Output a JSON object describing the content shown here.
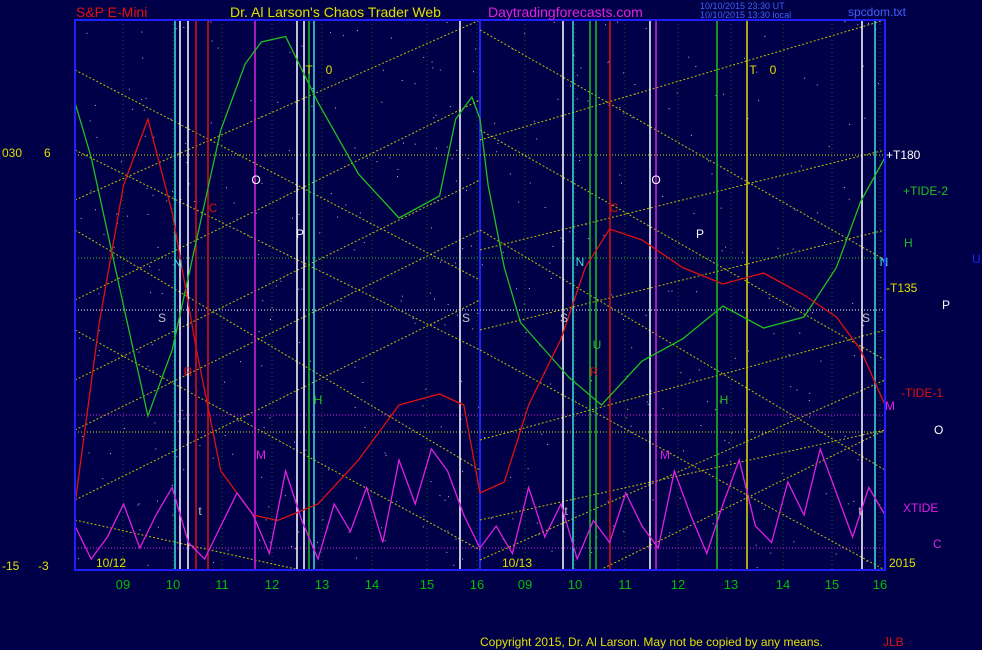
{
  "header": {
    "instrument": "S&P E-Mini",
    "title": "Dr. Al Larson's Chaos Trader Web",
    "site": "Daytradingforecasts.com",
    "stamp_line1": "10/10/2015 23:30 UT",
    "stamp_line2": "10/10/2015 13:30 local",
    "file": "spcdom.txt"
  },
  "left_scale": {
    "top_a": "030",
    "top_b": "6",
    "bottom_a": "-15",
    "bottom_b": "-3"
  },
  "right_labels": {
    "t180": "+T180",
    "tide2": "+TIDE-2",
    "h": "H",
    "u": "U",
    "t135": "-T135",
    "p": "P",
    "tide1": "-TIDE-1",
    "m": "M",
    "o": "O",
    "xtide": "XTIDE",
    "c": "C",
    "year": "2015"
  },
  "copyright": "Copyright 2015, Dr. Al Larson. May not be copied by any means.",
  "copyright_tail": "JLB",
  "colors": {
    "background": "#000048",
    "frame": "#2020ff",
    "red": "#e01010",
    "green": "#20c020",
    "magenta": "#e020e0",
    "yellow": "#e0e000",
    "cyan": "#40e0e0",
    "white": "#ffffff"
  },
  "chart_data": {
    "type": "line",
    "x_ticks": [
      "09",
      "10",
      "11",
      "12",
      "13",
      "14",
      "15",
      "16",
      "09",
      "10",
      "11",
      "12",
      "13",
      "14",
      "15",
      "16"
    ],
    "day_labels": [
      "10/12",
      "10/13"
    ],
    "planet_markers": [
      "N",
      "S",
      "O",
      "P",
      "C",
      "H",
      "M",
      "R",
      "T",
      "0",
      "t",
      "U"
    ],
    "y_range": [
      -15,
      30
    ],
    "series": [
      {
        "name": "+TIDE-2",
        "color": "#20c020",
        "x": [
          0,
          0.02,
          0.06,
          0.09,
          0.12,
          0.15,
          0.18,
          0.21,
          0.23,
          0.26,
          0.3,
          0.35,
          0.4,
          0.45,
          0.47,
          0.49,
          0.5,
          0.51,
          0.53,
          0.55,
          0.58,
          0.61,
          0.65,
          0.7,
          0.75,
          0.8,
          0.85,
          0.9,
          0.94,
          0.97,
          1.0
        ],
        "y": [
          0.85,
          0.75,
          0.48,
          0.28,
          0.4,
          0.6,
          0.8,
          0.92,
          0.96,
          0.97,
          0.85,
          0.72,
          0.64,
          0.68,
          0.82,
          0.86,
          0.82,
          0.7,
          0.55,
          0.45,
          0.4,
          0.35,
          0.3,
          0.38,
          0.42,
          0.48,
          0.44,
          0.46,
          0.55,
          0.67,
          0.75
        ]
      },
      {
        "name": "-TIDE-1",
        "color": "#e01010",
        "x": [
          0,
          0.03,
          0.06,
          0.09,
          0.12,
          0.15,
          0.18,
          0.22,
          0.25,
          0.3,
          0.35,
          0.4,
          0.45,
          0.48,
          0.5,
          0.53,
          0.56,
          0.6,
          0.63,
          0.66,
          0.7,
          0.75,
          0.8,
          0.85,
          0.9,
          0.94,
          0.97,
          1.0
        ],
        "y": [
          0.12,
          0.45,
          0.7,
          0.82,
          0.65,
          0.4,
          0.18,
          0.1,
          0.09,
          0.12,
          0.2,
          0.3,
          0.32,
          0.3,
          0.14,
          0.16,
          0.3,
          0.42,
          0.55,
          0.62,
          0.6,
          0.55,
          0.52,
          0.54,
          0.5,
          0.46,
          0.4,
          0.3
        ]
      },
      {
        "name": "XTIDE",
        "color": "#e020e0",
        "x": [
          0,
          0.02,
          0.04,
          0.06,
          0.08,
          0.1,
          0.12,
          0.14,
          0.16,
          0.18,
          0.2,
          0.22,
          0.24,
          0.26,
          0.28,
          0.3,
          0.32,
          0.34,
          0.36,
          0.38,
          0.4,
          0.42,
          0.44,
          0.46,
          0.48,
          0.5,
          0.52,
          0.54,
          0.56,
          0.58,
          0.6,
          0.62,
          0.64,
          0.66,
          0.68,
          0.7,
          0.72,
          0.74,
          0.76,
          0.78,
          0.8,
          0.82,
          0.84,
          0.86,
          0.88,
          0.9,
          0.92,
          0.94,
          0.96,
          0.98,
          1.0
        ],
        "y": [
          0.08,
          0.02,
          0.06,
          0.12,
          0.04,
          0.1,
          0.15,
          0.05,
          0.02,
          0.08,
          0.14,
          0.1,
          0.03,
          0.18,
          0.09,
          0.02,
          0.12,
          0.07,
          0.15,
          0.05,
          0.2,
          0.12,
          0.22,
          0.18,
          0.1,
          0.04,
          0.08,
          0.03,
          0.15,
          0.06,
          0.12,
          0.02,
          0.09,
          0.05,
          0.14,
          0.08,
          0.04,
          0.18,
          0.1,
          0.03,
          0.12,
          0.2,
          0.08,
          0.05,
          0.16,
          0.1,
          0.22,
          0.14,
          0.06,
          0.15,
          0.1
        ]
      }
    ]
  }
}
